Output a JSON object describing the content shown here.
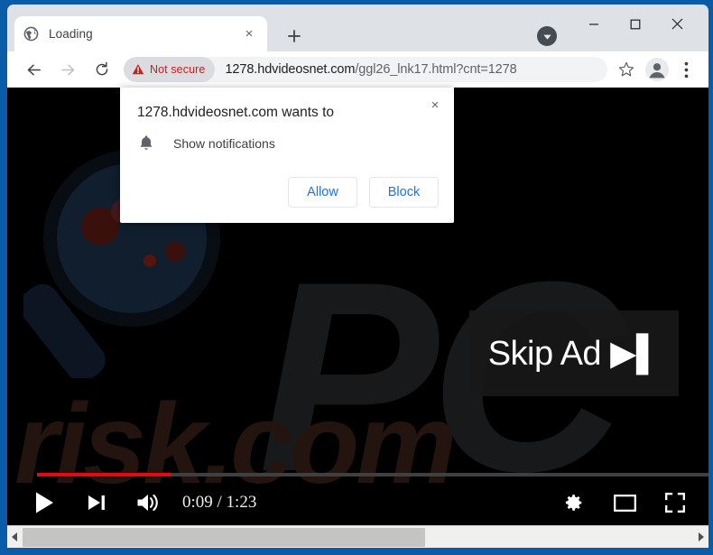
{
  "window": {
    "controls": {
      "minimize": "minimize",
      "maximize": "maximize",
      "close": "close"
    },
    "update_badge_icon": "update-arrow-icon"
  },
  "tabstrip": {
    "tab": {
      "favicon": "globe-icon",
      "title": "Loading",
      "close_label": "×"
    },
    "new_tab_label": "+"
  },
  "toolbar": {
    "back_icon": "arrow-left-icon",
    "forward_icon": "arrow-right-icon",
    "reload_icon": "reload-icon",
    "security_badge": {
      "icon": "warning-triangle-icon",
      "label": "Not secure",
      "color": "#c5221f"
    },
    "url": {
      "host": "1278.hdvideosnet.com",
      "path": "/ggl26_lnk17.html?cnt=1278",
      "full": "1278.hdvideosnet.com/ggl26_lnk17.html?cnt=1278"
    },
    "bookmark_icon": "star-icon",
    "profile_icon": "user-avatar-icon",
    "menu_icon": "three-dot-menu-icon"
  },
  "permission_dialog": {
    "title": "1278.hdvideosnet.com wants to",
    "permission_icon": "bell-icon",
    "permission_label": "Show notifications",
    "allow_label": "Allow",
    "block_label": "Block",
    "close_label": "×",
    "accent_color": "#1a73e8"
  },
  "video": {
    "watermark_primary": "PC",
    "watermark_secondary": "risk.com",
    "graphic": "magnifying-glass-icon",
    "skip_ad": {
      "label": "Skip Ad ▶▌",
      "text": "Skip Ad"
    },
    "controls": {
      "play_icon": "play-icon",
      "next_icon": "next-track-icon",
      "volume_icon": "volume-icon",
      "time": "0:09 / 1:23",
      "current_time": "0:09",
      "duration": "1:23",
      "settings_icon": "gear-icon",
      "theater_icon": "theater-mode-icon",
      "fullscreen_icon": "fullscreen-icon",
      "progress_percent": 20,
      "progress_color": "#e50914"
    }
  },
  "scrollbar": {
    "left_arrow": "◀",
    "right_arrow": "▶",
    "thumb_percent": 60
  }
}
